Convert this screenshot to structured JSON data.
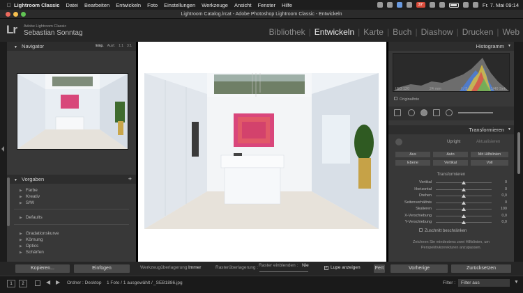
{
  "menubar": {
    "app": "Lightroom Classic",
    "items": [
      "Datei",
      "Bearbeiten",
      "Entwickeln",
      "Foto",
      "Einstellungen",
      "Werkzeuge",
      "Ansicht",
      "Fenster",
      "Hilfe"
    ],
    "temp_badge": "39°",
    "clock": "Fr. 7. Mai  09:14"
  },
  "titlebar": {
    "title": "Lightroom Catalog.lrcat - Adobe Photoshop Lightroom Classic - Entwickeln"
  },
  "identity": {
    "logo": "Lr",
    "subtitle": "Adobe Lightroom Classic",
    "name": "Sebastian Sonntag"
  },
  "modules": [
    {
      "label": "Bibliothek",
      "active": false
    },
    {
      "label": "Entwickeln",
      "active": true
    },
    {
      "label": "Karte",
      "active": false
    },
    {
      "label": "Buch",
      "active": false
    },
    {
      "label": "Diashow",
      "active": false
    },
    {
      "label": "Drucken",
      "active": false
    },
    {
      "label": "Web",
      "active": false
    }
  ],
  "navigator": {
    "title": "Navigator",
    "zoom_options": [
      "Einp.",
      "Ausf.",
      "1:1",
      "3:1"
    ]
  },
  "presets": {
    "title": "Vorgaben",
    "add": "+",
    "group1": [
      "Farbe",
      "Kreativ",
      "S/W"
    ],
    "group2": [
      "Defaults"
    ],
    "group3": [
      "Gradationskurve",
      "Körnung",
      "Optics",
      "Schärfen"
    ]
  },
  "left_buttons": {
    "copy": "Kopieren...",
    "paste": "Einfügen"
  },
  "toolbar": {
    "overlay_label": "Werkzeugüberlagerung :",
    "overlay_value": "Immer",
    "grid_label": "Rasterüberlagerung :",
    "grid_show_label": "Raster einblenden :",
    "grid_show_value": "Nie",
    "loupe_label": "Lupe anzeigen",
    "done": "Fert"
  },
  "histogram": {
    "title": "Histogramm",
    "iso": "ISO 120",
    "focal": "24 mm",
    "aperture": "f / 5,6",
    "shutter": "1/40 Sek.",
    "original_label": "Originalfoto"
  },
  "transform": {
    "title": "Transformieren",
    "upright_label": "Upright",
    "reanalyze_label": "Aktualisieren",
    "buttons_row1": [
      "Aus",
      "Auto",
      "Mit Hilfslinien"
    ],
    "buttons_row2": [
      "Ebene",
      "Vertikal",
      "Voll"
    ],
    "section": "Transformieren",
    "sliders": [
      {
        "label": "Vertikal",
        "value": "0",
        "pos": 0.5
      },
      {
        "label": "Horizontal",
        "value": "0",
        "pos": 0.5
      },
      {
        "label": "Drehen",
        "value": "0,0",
        "pos": 0.5
      },
      {
        "label": "Seitenverhältnis",
        "value": "0",
        "pos": 0.5
      },
      {
        "label": "Skalieren",
        "value": "100",
        "pos": 0.5
      },
      {
        "label": "X-Verschiebung",
        "value": "0,0",
        "pos": 0.5
      },
      {
        "label": "Y-Verschiebung",
        "value": "0,0",
        "pos": 0.5
      }
    ],
    "constrain_label": "Zuschnitt beschränken",
    "hint_line1": "Zeichnen Sie mindestens zwei Hilfslinien, um",
    "hint_line2": "Perspektivkorrekturen anzupassen."
  },
  "right_buttons": {
    "previous": "Vorherige",
    "reset": "Zurücksetzen"
  },
  "filmstrip": {
    "screen1": "1",
    "screen2": "2",
    "path": "Ordner : Desktop",
    "count": "1 Foto / 1 ausgewählt /",
    "filename": "_SEB1886.jpg",
    "filter_label": "Filter :",
    "filter_value": "Filter aus"
  }
}
